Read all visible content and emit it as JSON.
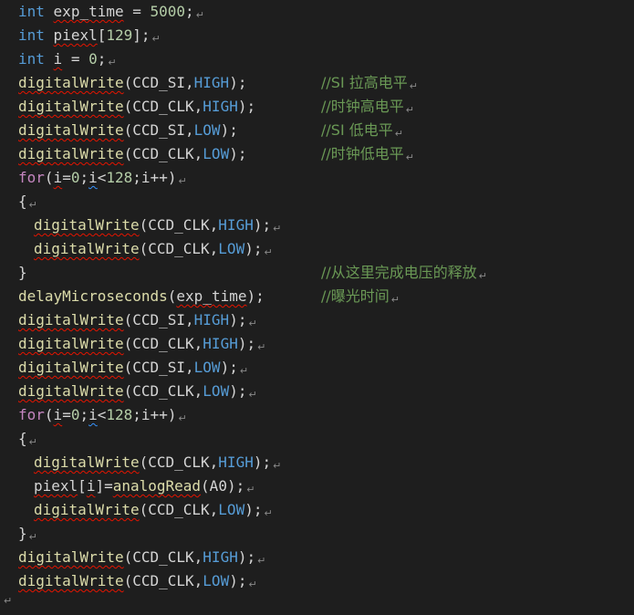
{
  "paragraph_mark": "↵",
  "lines": [
    {
      "parts": [
        [
          "int",
          "kw"
        ],
        [
          " "
        ],
        [
          "exp_time",
          "sq"
        ],
        [
          " = "
        ],
        [
          "5000",
          "num"
        ],
        [
          ";"
        ]
      ],
      "mark": true
    },
    {
      "parts": [
        [
          "int",
          "kw"
        ],
        [
          " "
        ],
        [
          "piexl",
          "sq"
        ],
        [
          "["
        ],
        [
          "129",
          "num"
        ],
        [
          "];"
        ]
      ],
      "mark": true
    },
    {
      "parts": [
        [
          "int",
          "kw"
        ],
        [
          " "
        ],
        [
          "i",
          "sq"
        ],
        [
          " = "
        ],
        [
          "0",
          "num"
        ],
        [
          ";"
        ]
      ],
      "mark": true
    },
    {
      "parts": [
        [
          "digitalWrite",
          "fn sq"
        ],
        [
          "(CCD_SI,"
        ],
        [
          "HIGH",
          "const"
        ],
        [
          ");"
        ]
      ],
      "mark": false,
      "comment": "//SI 拉高电平"
    },
    {
      "parts": [
        [
          "digitalWrite",
          "fn sq"
        ],
        [
          "(CCD_CLK,"
        ],
        [
          "HIGH",
          "const"
        ],
        [
          ");"
        ]
      ],
      "mark": false,
      "comment": "//时钟高电平"
    },
    {
      "parts": [
        [
          "digitalWrite",
          "fn sq"
        ],
        [
          "(CCD_SI,"
        ],
        [
          "LOW",
          "const"
        ],
        [
          ");"
        ]
      ],
      "mark": false,
      "comment": "//SI 低电平"
    },
    {
      "parts": [
        [
          "digitalWrite",
          "fn sq"
        ],
        [
          "(CCD_CLK,"
        ],
        [
          "LOW",
          "const"
        ],
        [
          ");"
        ]
      ],
      "mark": false,
      "comment": "//时钟低电平"
    },
    {
      "parts": [
        [
          "for",
          "cf"
        ],
        [
          "("
        ],
        [
          "i",
          "sq"
        ],
        [
          "="
        ],
        [
          "0",
          "num"
        ],
        [
          ";"
        ],
        [
          "i",
          "sqb"
        ],
        [
          "<"
        ],
        [
          "128",
          "num"
        ],
        [
          ";i++)"
        ]
      ],
      "mark": true
    },
    {
      "parts": [
        [
          "{"
        ]
      ],
      "mark": true
    },
    {
      "indent": true,
      "parts": [
        [
          "digitalWrite",
          "fn sq"
        ],
        [
          "(CCD_CLK,"
        ],
        [
          "HIGH",
          "const"
        ],
        [
          ");"
        ]
      ],
      "mark": true
    },
    {
      "indent": true,
      "parts": [
        [
          "digitalWrite",
          "fn sq"
        ],
        [
          "(CCD_CLK,"
        ],
        [
          "LOW",
          "const"
        ],
        [
          ");"
        ]
      ],
      "mark": true
    },
    {
      "parts": [
        [
          "}"
        ]
      ],
      "mark": false,
      "comment": "//从这里完成电压的释放"
    },
    {
      "parts": [
        [
          "delayMicroseconds",
          "fn"
        ],
        [
          "("
        ],
        [
          "exp_time",
          "sq"
        ],
        [
          ");"
        ]
      ],
      "mark": false,
      "comment": "//曝光时间"
    },
    {
      "parts": [
        [
          "digitalWrite",
          "fn sq"
        ],
        [
          "(CCD_SI,"
        ],
        [
          "HIGH",
          "const"
        ],
        [
          ");"
        ]
      ],
      "mark": true
    },
    {
      "parts": [
        [
          "digitalWrite",
          "fn sq"
        ],
        [
          "(CCD_CLK,"
        ],
        [
          "HIGH",
          "const"
        ],
        [
          ");"
        ]
      ],
      "mark": true
    },
    {
      "parts": [
        [
          "digitalWrite",
          "fn sq"
        ],
        [
          "(CCD_SI,"
        ],
        [
          "LOW",
          "const"
        ],
        [
          ");"
        ]
      ],
      "mark": true
    },
    {
      "parts": [
        [
          "digitalWrite",
          "fn sq"
        ],
        [
          "(CCD_CLK,"
        ],
        [
          "LOW",
          "const"
        ],
        [
          ");"
        ]
      ],
      "mark": true
    },
    {
      "parts": [
        [
          "for",
          "cf"
        ],
        [
          "("
        ],
        [
          "i",
          "sq"
        ],
        [
          "="
        ],
        [
          "0",
          "num"
        ],
        [
          ";"
        ],
        [
          "i",
          "sqb"
        ],
        [
          "<"
        ],
        [
          "128",
          "num"
        ],
        [
          ";i++)"
        ]
      ],
      "mark": true
    },
    {
      "parts": [
        [
          "{"
        ]
      ],
      "mark": true
    },
    {
      "indent": true,
      "parts": [
        [
          "digitalWrite",
          "fn sq"
        ],
        [
          "(CCD_CLK,"
        ],
        [
          "HIGH",
          "const"
        ],
        [
          ");"
        ]
      ],
      "mark": true
    },
    {
      "indent": true,
      "parts": [
        [
          "piexl",
          "sq"
        ],
        [
          "["
        ],
        [
          "i",
          "sq"
        ],
        [
          "]="
        ],
        [
          "analogRead",
          "fn sq"
        ],
        [
          "(A0);"
        ]
      ],
      "mark": true
    },
    {
      "indent": true,
      "parts": [
        [
          "digitalWrite",
          "fn sq"
        ],
        [
          "(CCD_CLK,"
        ],
        [
          "LOW",
          "const"
        ],
        [
          ");"
        ]
      ],
      "mark": true
    },
    {
      "parts": [
        [
          "}"
        ]
      ],
      "mark": true
    },
    {
      "parts": [
        [
          "digitalWrite",
          "fn sq"
        ],
        [
          "(CCD_CLK,"
        ],
        [
          "HIGH",
          "const"
        ],
        [
          ");"
        ]
      ],
      "mark": true
    },
    {
      "parts": [
        [
          "digitalWrite",
          "fn sq"
        ],
        [
          "(CCD_CLK,"
        ],
        [
          "LOW",
          "const"
        ],
        [
          ");"
        ]
      ],
      "mark": true
    }
  ],
  "colors": {
    "background": "#1e1e1e",
    "text": "#d4d4d4",
    "keyword": "#569cd6",
    "function": "#dcdcaa",
    "control": "#c586c0",
    "number": "#b5cea8",
    "comment": "#6a9955",
    "squiggle_error": "#e51400",
    "squiggle_info": "#3794ff"
  }
}
